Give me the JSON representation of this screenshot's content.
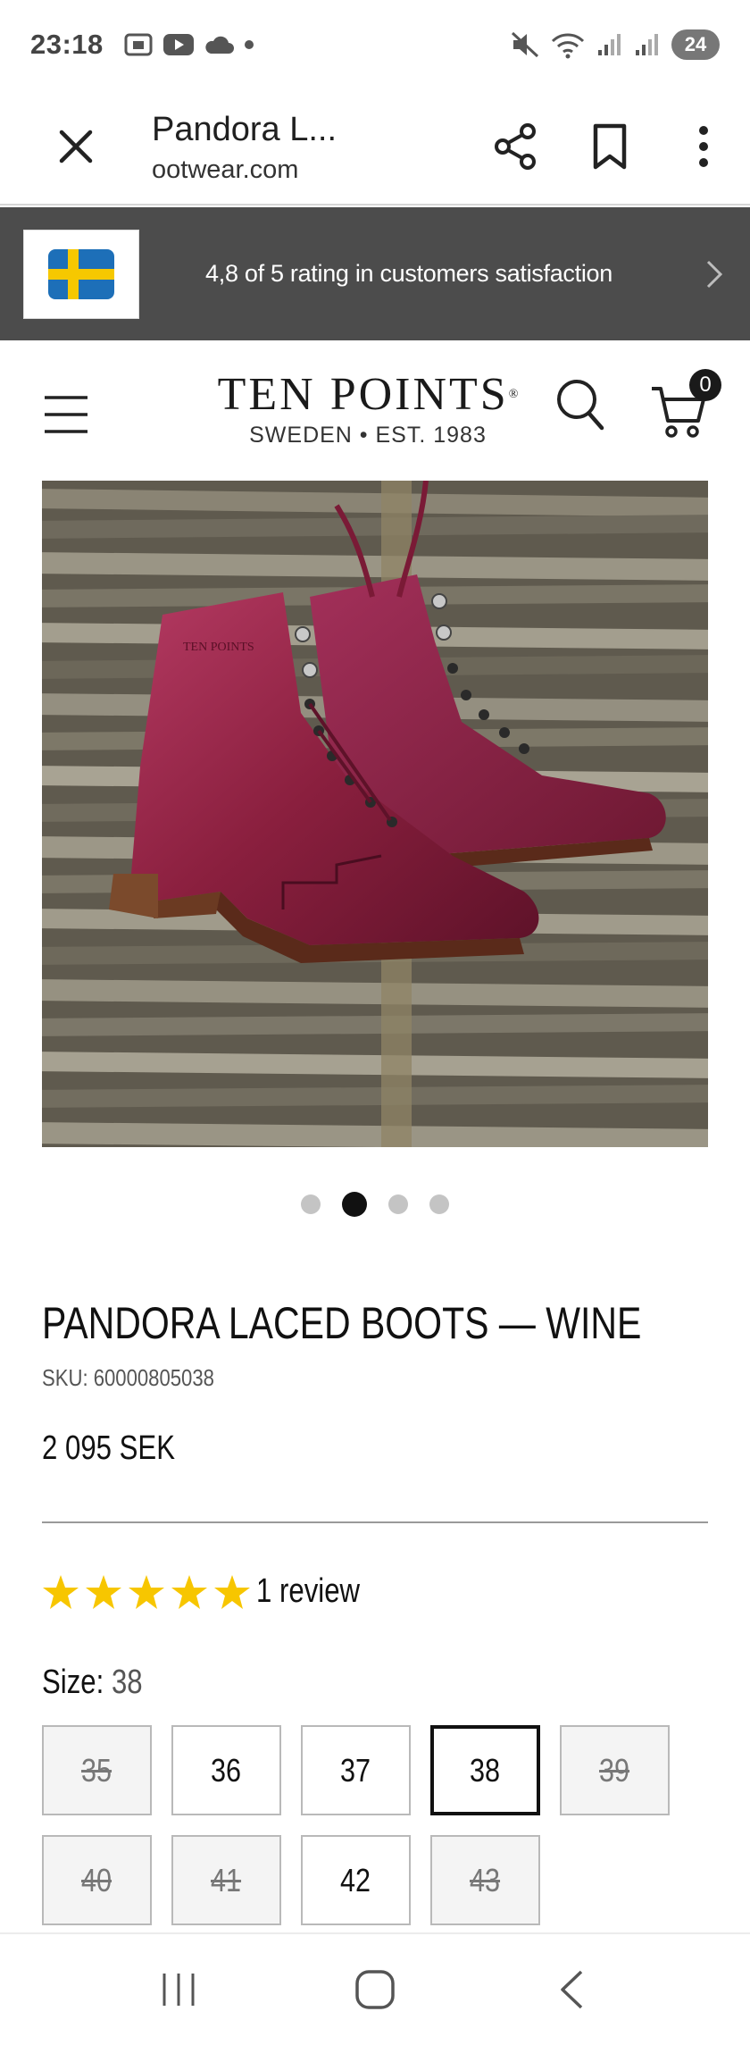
{
  "status_bar": {
    "time": "23:18",
    "battery": "24",
    "icons": [
      "screenshot-icon",
      "youtube-icon",
      "cloud-icon",
      "dot-icon",
      "mute-icon",
      "wifi-icon",
      "signal-icon",
      "signal-icon"
    ]
  },
  "browser": {
    "title": "Pandora L...",
    "url": "ootwear.com",
    "actions": [
      "share-icon",
      "bookmark-icon",
      "more-icon"
    ]
  },
  "promo": {
    "text": "4,8 of 5 rating in customers satisfaction",
    "flag": "sweden-flag"
  },
  "header": {
    "logo_main": "TEN POINTS",
    "logo_reg": "®",
    "logo_sub": "SWEDEN • EST. 1983",
    "cart_count": "0"
  },
  "carousel": {
    "count": 4,
    "active": 2
  },
  "product": {
    "title": "PANDORA LACED BOOTS — WINE",
    "sku": "SKU: 60000805038",
    "price": "2 095 SEK",
    "rating": 5,
    "review_count": "1 review",
    "size_label": "Size:",
    "size_value": "38",
    "sizes": [
      {
        "label": "35",
        "state": "unavailable"
      },
      {
        "label": "36",
        "state": "available"
      },
      {
        "label": "37",
        "state": "available"
      },
      {
        "label": "38",
        "state": "selected"
      },
      {
        "label": "39",
        "state": "unavailable"
      },
      {
        "label": "40",
        "state": "unavailable"
      },
      {
        "label": "41",
        "state": "unavailable"
      },
      {
        "label": "42",
        "state": "available"
      },
      {
        "label": "43",
        "state": "unavailable"
      }
    ]
  },
  "colors": {
    "promo_bg": "#4c4c4c",
    "star": "#f7c600",
    "boot_wine": "#8a1f3e"
  }
}
